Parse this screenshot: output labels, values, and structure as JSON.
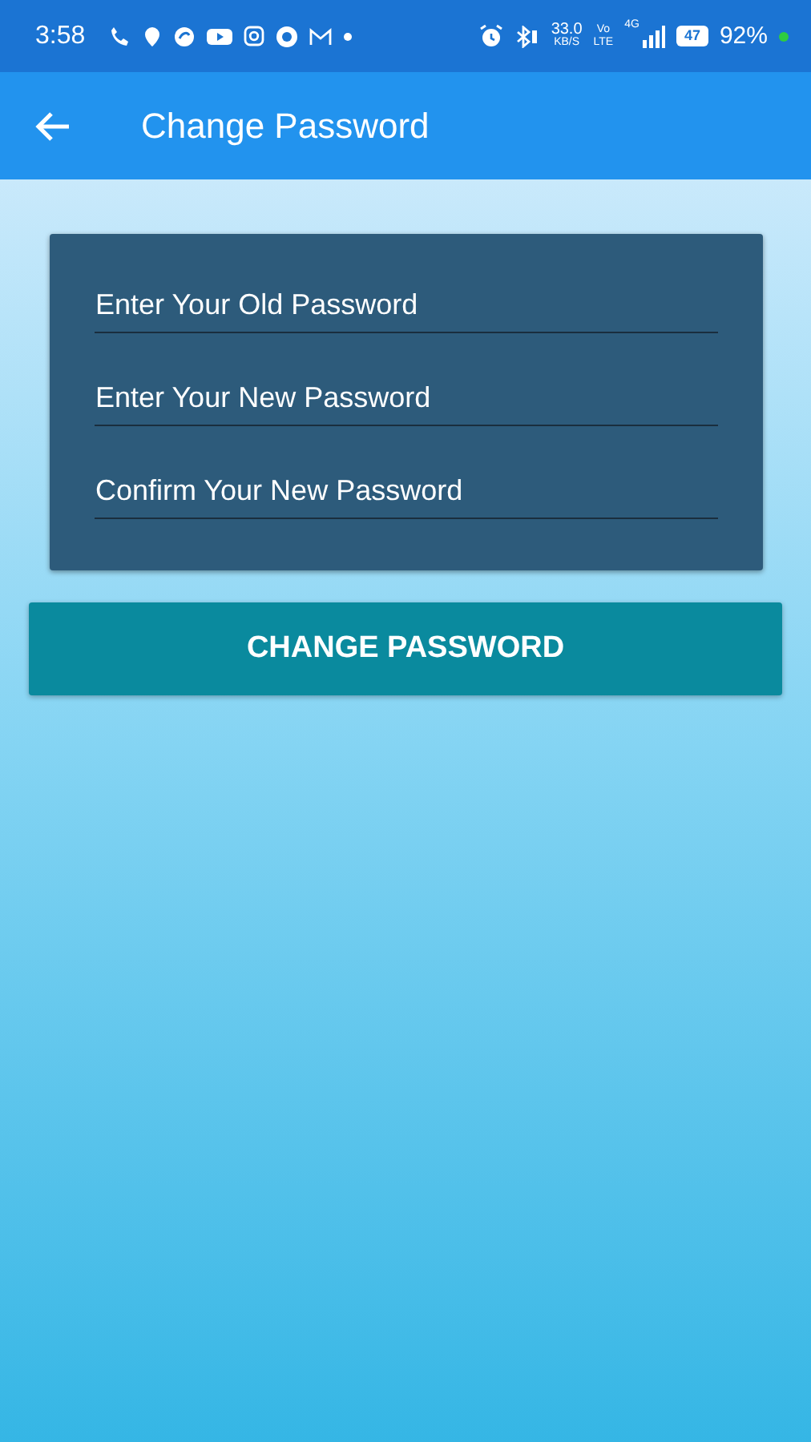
{
  "status_bar": {
    "time": "3:58",
    "network_speed": "33.0",
    "speed_unit": "KB/S",
    "volte_top": "Vo",
    "volte_bottom": "LTE",
    "network_type": "4G",
    "battery_level_text": "47",
    "battery": "92%"
  },
  "app_bar": {
    "title": "Change Password"
  },
  "fields": [
    {
      "placeholder": "Enter Your Old Password"
    },
    {
      "placeholder": "Enter Your New Password"
    },
    {
      "placeholder": "Confirm Your New Password"
    }
  ],
  "button": {
    "label": "CHANGE PASSWORD"
  }
}
